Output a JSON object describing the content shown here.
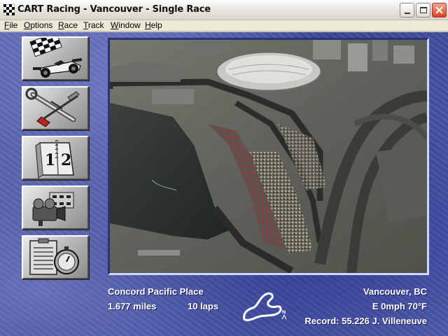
{
  "window": {
    "title": "CART Racing - Vancouver - Single Race"
  },
  "menu": {
    "items": [
      {
        "label": "File",
        "key": "F"
      },
      {
        "label": "Options",
        "key": "O"
      },
      {
        "label": "Race",
        "key": "R"
      },
      {
        "label": "Track",
        "key": "T"
      },
      {
        "label": "Window",
        "key": "W"
      },
      {
        "label": "Help",
        "key": "H"
      }
    ]
  },
  "toolbar": {
    "buttons": [
      {
        "id": "race-car",
        "icon": "race-car-checkered-flag-icon"
      },
      {
        "id": "garage",
        "icon": "wrench-screwdriver-icon"
      },
      {
        "id": "schedule",
        "icon": "calendar-book-icon"
      },
      {
        "id": "replay",
        "icon": "video-camera-film-icon"
      },
      {
        "id": "results",
        "icon": "clipboard-stopwatch-icon"
      }
    ]
  },
  "track": {
    "name": "Concord Pacific Place",
    "length": "1.677 miles",
    "laps": "10 laps",
    "location": "Vancouver, BC",
    "weather": "E 0mph  70°F",
    "record": "Record: 55.226 J. Villeneuve",
    "map_icon": "track-outline-map-icon",
    "north_label": "N"
  },
  "colors": {
    "background_blue": "#3c4797",
    "info_text": "#ffffff"
  }
}
